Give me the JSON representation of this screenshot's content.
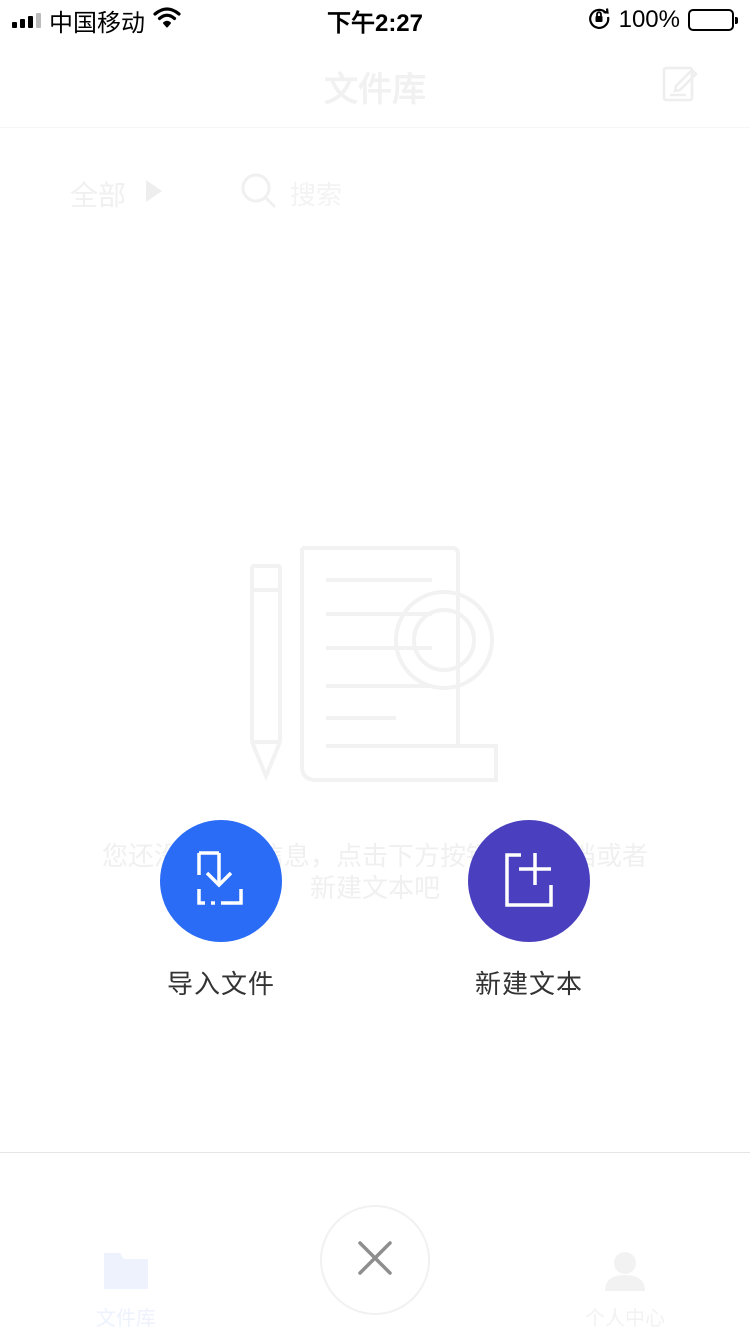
{
  "status_bar": {
    "carrier": "中国移动",
    "time": "下午2:27",
    "battery": "100%",
    "battery_level": 1.0
  },
  "background_page": {
    "title": "文件库",
    "filter": {
      "label": "全部"
    },
    "search": {
      "placeholder": "搜索"
    },
    "empty_text": "您还没有文档信息，点击下方按钮导入文档或者新建文本吧"
  },
  "actions": {
    "import": {
      "label": "导入文件",
      "icon": "import-file-icon"
    },
    "create": {
      "label": "新建文本",
      "icon": "new-document-icon"
    }
  },
  "tab_bar": {
    "files": {
      "label": "文件库",
      "icon": "folder-icon"
    },
    "center": {
      "icon": "close-icon"
    },
    "profile": {
      "label": "个人中心",
      "icon": "person-icon"
    }
  },
  "colors": {
    "import_button": "#2a6cf6",
    "create_button": "#4a3fbf",
    "close_icon": "#8e8e8e"
  }
}
